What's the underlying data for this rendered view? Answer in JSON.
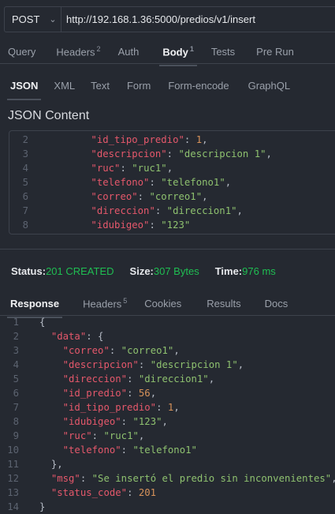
{
  "request": {
    "method": "POST",
    "url": "http://192.168.1.36:5000/predios/v1/insert",
    "tabs": [
      {
        "label": "Query",
        "badge": ""
      },
      {
        "label": "Headers",
        "badge": "2"
      },
      {
        "label": "Auth",
        "badge": ""
      },
      {
        "label": "Body",
        "badge": "1"
      },
      {
        "label": "Tests",
        "badge": ""
      },
      {
        "label": "Pre Run",
        "badge": ""
      }
    ],
    "body_types": [
      "JSON",
      "XML",
      "Text",
      "Form",
      "Form-encode",
      "GraphQL"
    ],
    "content_title": "JSON Content",
    "lines": [
      {
        "n": "2",
        "indent": 6,
        "tokens": [
          [
            "k",
            "\"id_tipo_predio\""
          ],
          [
            "p",
            ": "
          ],
          [
            "n",
            "1"
          ],
          [
            "p",
            ","
          ]
        ]
      },
      {
        "n": "3",
        "indent": 6,
        "tokens": [
          [
            "k",
            "\"descripcion\""
          ],
          [
            "p",
            ": "
          ],
          [
            "s",
            "\"descripcion 1\""
          ],
          [
            "p",
            ","
          ]
        ]
      },
      {
        "n": "4",
        "indent": 6,
        "tokens": [
          [
            "k",
            "\"ruc\""
          ],
          [
            "p",
            ": "
          ],
          [
            "s",
            "\"ruc1\""
          ],
          [
            "p",
            ","
          ]
        ]
      },
      {
        "n": "5",
        "indent": 6,
        "tokens": [
          [
            "k",
            "\"telefono\""
          ],
          [
            "p",
            ": "
          ],
          [
            "s",
            "\"telefono1\""
          ],
          [
            "p",
            ","
          ]
        ]
      },
      {
        "n": "6",
        "indent": 6,
        "tokens": [
          [
            "k",
            "\"correo\""
          ],
          [
            "p",
            ": "
          ],
          [
            "s",
            "\"correo1\""
          ],
          [
            "p",
            ","
          ]
        ]
      },
      {
        "n": "7",
        "indent": 6,
        "tokens": [
          [
            "k",
            "\"direccion\""
          ],
          [
            "p",
            ": "
          ],
          [
            "s",
            "\"direccion1\""
          ],
          [
            "p",
            ","
          ]
        ]
      },
      {
        "n": "8",
        "indent": 6,
        "tokens": [
          [
            "k",
            "\"idubigeo\""
          ],
          [
            "p",
            ": "
          ],
          [
            "s",
            "\"123\""
          ]
        ]
      }
    ]
  },
  "status": {
    "status_label": "Status: ",
    "status_value": "201 CREATED",
    "size_label": "Size: ",
    "size_value": "307 Bytes",
    "time_label": "Time: ",
    "time_value": "976 ms"
  },
  "response": {
    "tabs": [
      {
        "label": "Response",
        "badge": ""
      },
      {
        "label": "Headers",
        "badge": "5"
      },
      {
        "label": "Cookies",
        "badge": ""
      },
      {
        "label": "Results",
        "badge": ""
      },
      {
        "label": "Docs",
        "badge": ""
      }
    ],
    "lines": [
      {
        "n": "1",
        "indent": 0,
        "tokens": [
          [
            "p",
            "{"
          ]
        ]
      },
      {
        "n": "2",
        "indent": 2,
        "tokens": [
          [
            "k",
            "\"data\""
          ],
          [
            "p",
            ": {"
          ]
        ]
      },
      {
        "n": "3",
        "indent": 4,
        "tokens": [
          [
            "k",
            "\"correo\""
          ],
          [
            "p",
            ": "
          ],
          [
            "s",
            "\"correo1\""
          ],
          [
            "p",
            ","
          ]
        ]
      },
      {
        "n": "4",
        "indent": 4,
        "tokens": [
          [
            "k",
            "\"descripcion\""
          ],
          [
            "p",
            ": "
          ],
          [
            "s",
            "\"descripcion 1\""
          ],
          [
            "p",
            ","
          ]
        ]
      },
      {
        "n": "5",
        "indent": 4,
        "tokens": [
          [
            "k",
            "\"direccion\""
          ],
          [
            "p",
            ": "
          ],
          [
            "s",
            "\"direccion1\""
          ],
          [
            "p",
            ","
          ]
        ]
      },
      {
        "n": "6",
        "indent": 4,
        "tokens": [
          [
            "k",
            "\"id_predio\""
          ],
          [
            "p",
            ": "
          ],
          [
            "n",
            "56"
          ],
          [
            "p",
            ","
          ]
        ]
      },
      {
        "n": "7",
        "indent": 4,
        "tokens": [
          [
            "k",
            "\"id_tipo_predio\""
          ],
          [
            "p",
            ": "
          ],
          [
            "n",
            "1"
          ],
          [
            "p",
            ","
          ]
        ]
      },
      {
        "n": "8",
        "indent": 4,
        "tokens": [
          [
            "k",
            "\"idubigeo\""
          ],
          [
            "p",
            ": "
          ],
          [
            "s",
            "\"123\""
          ],
          [
            "p",
            ","
          ]
        ]
      },
      {
        "n": "9",
        "indent": 4,
        "tokens": [
          [
            "k",
            "\"ruc\""
          ],
          [
            "p",
            ": "
          ],
          [
            "s",
            "\"ruc1\""
          ],
          [
            "p",
            ","
          ]
        ]
      },
      {
        "n": "10",
        "indent": 4,
        "tokens": [
          [
            "k",
            "\"telefono\""
          ],
          [
            "p",
            ": "
          ],
          [
            "s",
            "\"telefono1\""
          ]
        ]
      },
      {
        "n": "11",
        "indent": 2,
        "tokens": [
          [
            "p",
            "},"
          ]
        ]
      },
      {
        "n": "12",
        "indent": 2,
        "tokens": [
          [
            "k",
            "\"msg\""
          ],
          [
            "p",
            ": "
          ],
          [
            "s",
            "\"Se insertó el predio sin inconvenientes\""
          ],
          [
            "p",
            ","
          ]
        ]
      },
      {
        "n": "13",
        "indent": 2,
        "tokens": [
          [
            "k",
            "\"status_code\""
          ],
          [
            "p",
            ": "
          ],
          [
            "n",
            "201"
          ]
        ]
      },
      {
        "n": "14",
        "indent": 0,
        "tokens": [
          [
            "p",
            "}"
          ]
        ]
      }
    ]
  }
}
